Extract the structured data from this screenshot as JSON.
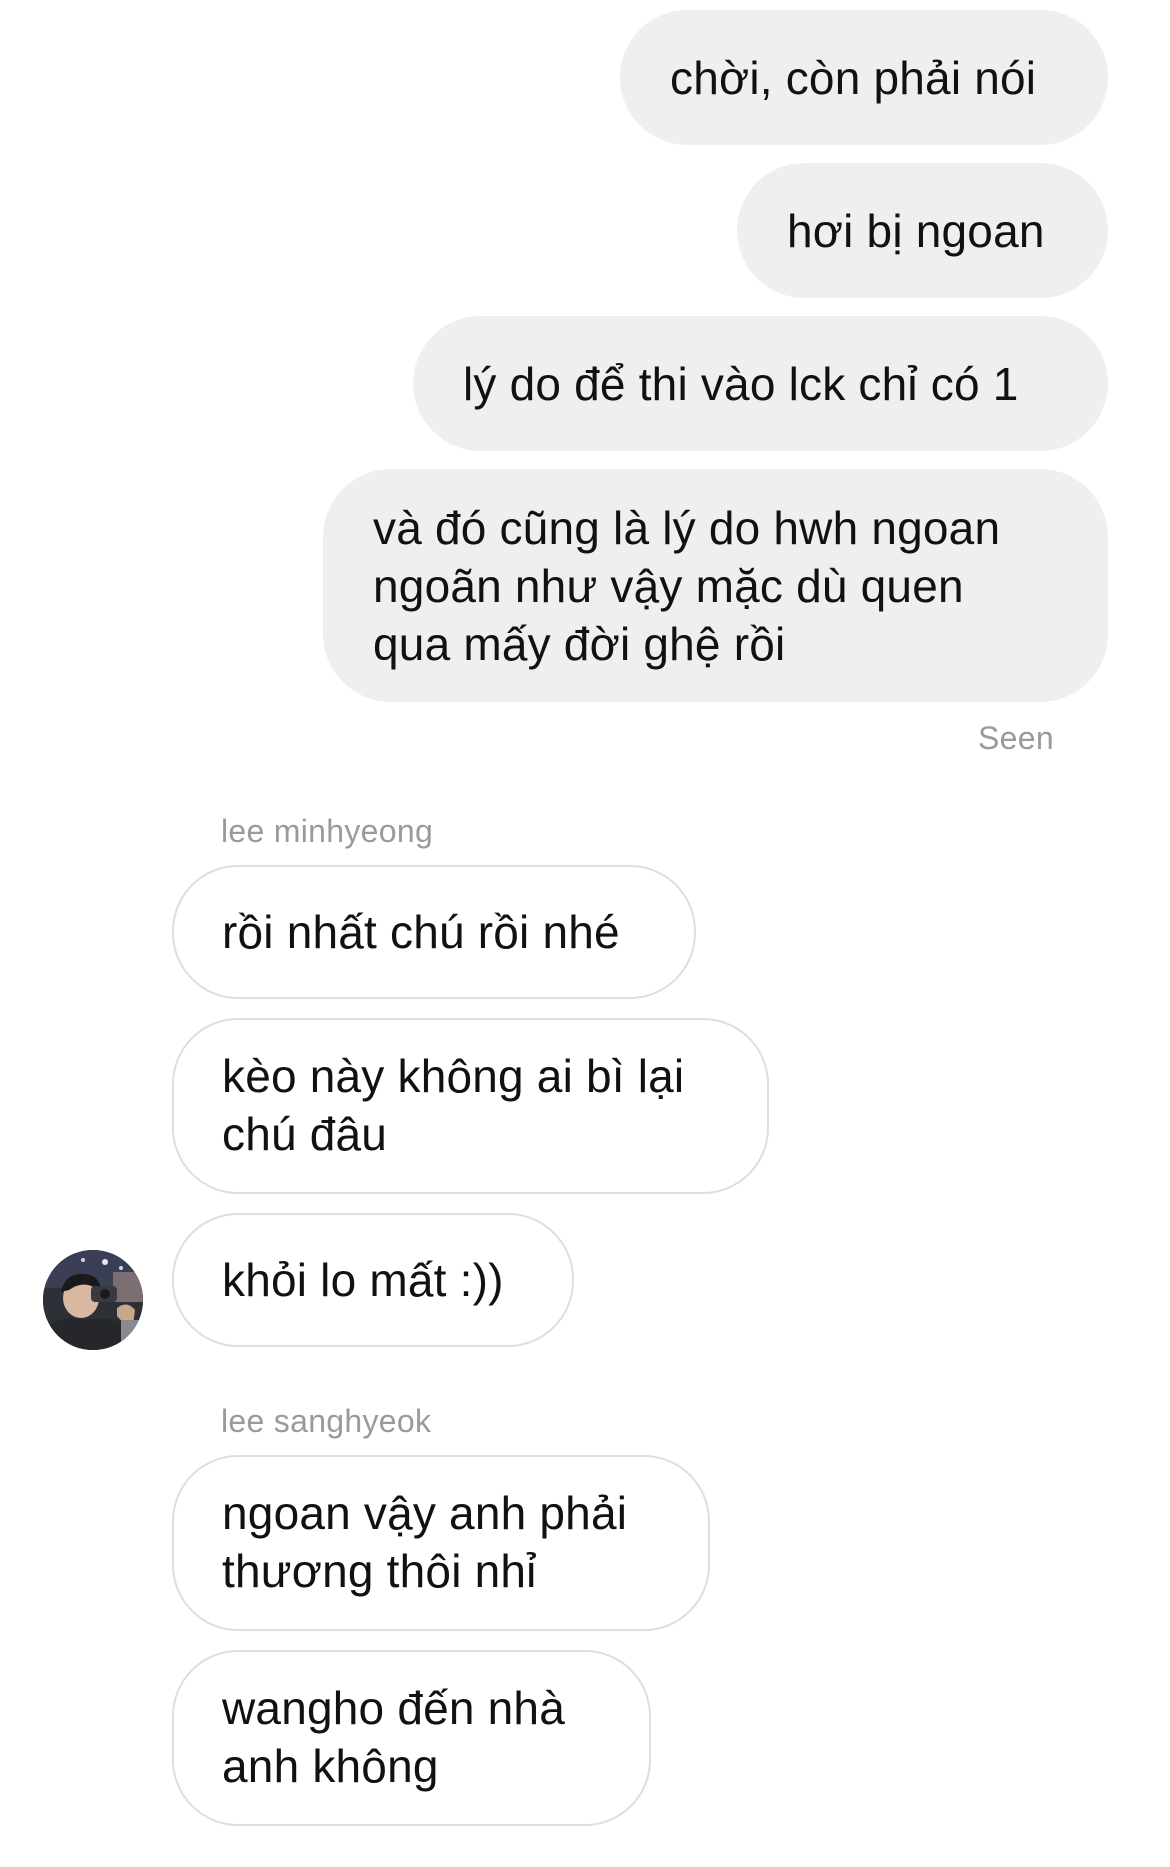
{
  "conversation": {
    "sent_messages": [
      {
        "text": "chời, còn phải nói"
      },
      {
        "text": "hơi bị ngoan"
      },
      {
        "text": "lý do để thi vào lck chỉ có 1"
      },
      {
        "text": "và đó cũng là lý do hwh ngoan\nngoãn như vậy mặc dù quen\nqua mấy đời ghệ rồi"
      }
    ],
    "seen_label": "Seen",
    "groups": [
      {
        "sender": "lee minhyeong",
        "messages": [
          {
            "text": "rồi nhất chú rồi nhé"
          },
          {
            "text": "kèo này không ai bì lại\nchú đâu"
          },
          {
            "text": "khỏi lo mất :))"
          }
        ],
        "avatar_icon": "user-photo-avatar"
      },
      {
        "sender": "lee sanghyeok",
        "messages": [
          {
            "text": "ngoan vậy anh phải\nthương thôi nhỉ"
          },
          {
            "text": "wangho đến nhà\nanh không"
          }
        ]
      }
    ]
  },
  "colors": {
    "sent_bubble": "#efefef",
    "received_bubble_border": "#dedede",
    "meta_text": "#9a9a9a"
  }
}
